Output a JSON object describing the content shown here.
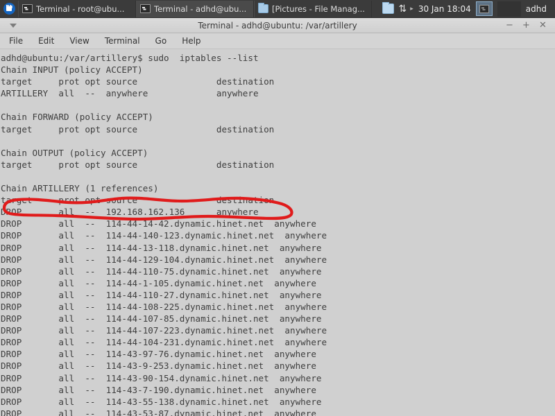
{
  "taskbar": {
    "start_button": "whisker-menu",
    "tasks": [
      {
        "icon": "terminal-icon",
        "label": "Terminal - root@ubu...",
        "active": false
      },
      {
        "icon": "terminal-icon",
        "label": "Terminal - adhd@ubu...",
        "active": true
      },
      {
        "icon": "folder-icon",
        "label": "[Pictures - File Manag...",
        "active": false
      }
    ],
    "tray": {
      "folder_icon": "folder-icon",
      "network_icon": "network-updown-icon",
      "caret": "▸",
      "clock": "30 Jan 18:04",
      "app_icon": "terminal-icon"
    },
    "user": "adhd"
  },
  "window": {
    "title": "Terminal - adhd@ubuntu: /var/artillery",
    "menu_button": "window-menu-caret",
    "buttons": {
      "minimize": "−",
      "maximize": "+",
      "close": "✕"
    }
  },
  "menubar": {
    "items": [
      "File",
      "Edit",
      "View",
      "Terminal",
      "Go",
      "Help"
    ]
  },
  "terminal": {
    "prompt": "adhd@ubuntu:/var/artillery$",
    "command": " sudo  iptables --list",
    "lines": [
      "adhd@ubuntu:/var/artillery$ sudo  iptables --list",
      "Chain INPUT (policy ACCEPT)",
      "target     prot opt source               destination",
      "ARTILLERY  all  --  anywhere             anywhere",
      "",
      "Chain FORWARD (policy ACCEPT)",
      "target     prot opt source               destination",
      "",
      "Chain OUTPUT (policy ACCEPT)",
      "target     prot opt source               destination",
      "",
      "Chain ARTILLERY (1 references)",
      "target     prot opt source               destination",
      "DROP       all  --  192.168.162.136      anywhere",
      "DROP       all  --  114-44-14-42.dynamic.hinet.net  anywhere",
      "DROP       all  --  114-44-140-123.dynamic.hinet.net  anywhere",
      "DROP       all  --  114-44-13-118.dynamic.hinet.net  anywhere",
      "DROP       all  --  114-44-129-104.dynamic.hinet.net  anywhere",
      "DROP       all  --  114-44-110-75.dynamic.hinet.net  anywhere",
      "DROP       all  --  114-44-1-105.dynamic.hinet.net  anywhere",
      "DROP       all  --  114-44-110-27.dynamic.hinet.net  anywhere",
      "DROP       all  --  114-44-108-225.dynamic.hinet.net  anywhere",
      "DROP       all  --  114-44-107-85.dynamic.hinet.net  anywhere",
      "DROP       all  --  114-44-107-223.dynamic.hinet.net  anywhere",
      "DROP       all  --  114-44-104-231.dynamic.hinet.net  anywhere",
      "DROP       all  --  114-43-97-76.dynamic.hinet.net  anywhere",
      "DROP       all  --  114-43-9-253.dynamic.hinet.net  anywhere",
      "DROP       all  --  114-43-90-154.dynamic.hinet.net  anywhere",
      "DROP       all  --  114-43-7-190.dynamic.hinet.net  anywhere",
      "DROP       all  --  114-43-55-138.dynamic.hinet.net  anywhere",
      "DROP       all  --  114-43-53-87.dynamic.hinet.net  anywhere"
    ]
  },
  "annotation": {
    "shape": "hand-drawn-ellipse",
    "color": "#e01b1b",
    "target_text": "DROP       all  --  192.168.162.136      anywhere"
  },
  "colors": {
    "taskbar_bg": "#3b3b3b",
    "titlebar_bg": "#d6d6d6",
    "terminal_bg": "#d0d0d0",
    "terminal_fg": "#3e3e3e",
    "annotation_red": "#e01b1b",
    "accent_blue": "#1565c0"
  }
}
